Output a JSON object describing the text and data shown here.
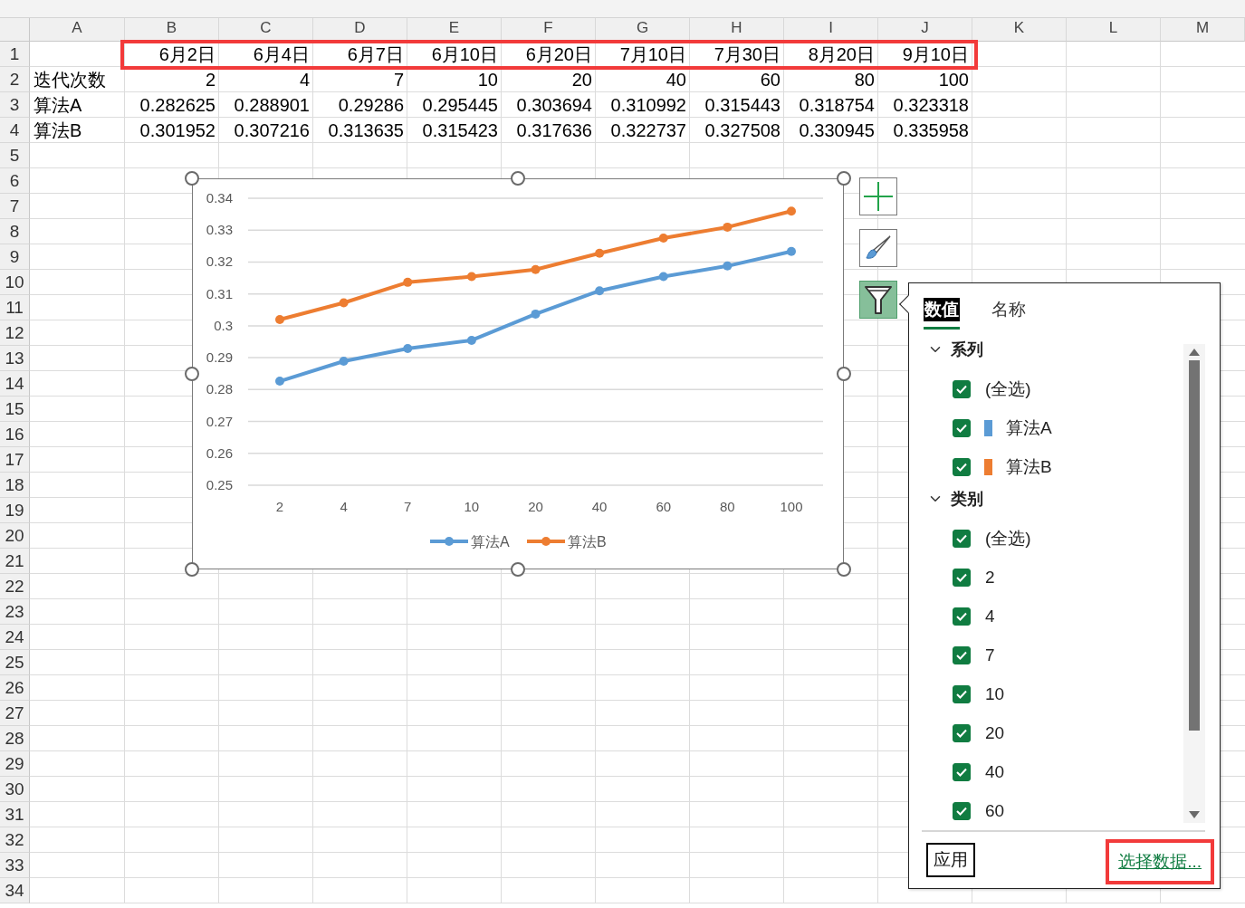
{
  "column_headers": [
    "A",
    "B",
    "C",
    "D",
    "E",
    "F",
    "G",
    "H",
    "I",
    "J",
    "K",
    "L",
    "M"
  ],
  "row_numbers": [
    "1",
    "2",
    "3",
    "4",
    "5",
    "6",
    "7",
    "8",
    "9",
    "10",
    "11",
    "12",
    "13",
    "14",
    "15",
    "16",
    "17",
    "18",
    "19",
    "20",
    "21",
    "22",
    "23",
    "24",
    "25",
    "26",
    "27",
    "28",
    "29",
    "30",
    "31",
    "32",
    "33",
    "34"
  ],
  "sheet_rows": [
    {
      "values": [
        "6月2日",
        "6月4日",
        "6月7日",
        "6月10日",
        "6月20日",
        "7月10日",
        "7月30日",
        "8月20日",
        "9月10日"
      ],
      "highlighted": true
    },
    {
      "label": "迭代次数",
      "values": [
        "2",
        "4",
        "7",
        "10",
        "20",
        "40",
        "60",
        "80",
        "100"
      ],
      "highlighted": false
    },
    {
      "label": "算法A",
      "values": [
        "0.282625",
        "0.288901",
        "0.29286",
        "0.295445",
        "0.303694",
        "0.310992",
        "0.315443",
        "0.318754",
        "0.323318"
      ],
      "highlighted": false
    },
    {
      "label": "算法B",
      "values": [
        "0.301952",
        "0.307216",
        "0.313635",
        "0.315423",
        "0.317636",
        "0.322737",
        "0.327508",
        "0.330945",
        "0.335958"
      ],
      "highlighted": false
    }
  ],
  "chart": {
    "selected": true,
    "chart_data": {
      "type": "line",
      "grid": true,
      "legend": true,
      "categories": [
        "2",
        "4",
        "7",
        "10",
        "20",
        "40",
        "60",
        "80",
        "100"
      ],
      "ylim": [
        0.25,
        0.34
      ],
      "yticks": [
        {
          "value": 0.25,
          "label": "0.25"
        },
        {
          "value": 0.26,
          "label": "0.26"
        },
        {
          "value": 0.27,
          "label": "0.27"
        },
        {
          "value": 0.28,
          "label": "0.28"
        },
        {
          "value": 0.29,
          "label": "0.29"
        },
        {
          "value": 0.3,
          "label": "0.3"
        },
        {
          "value": 0.31,
          "label": "0.31"
        },
        {
          "value": 0.32,
          "label": "0.32"
        },
        {
          "value": 0.33,
          "label": "0.33"
        },
        {
          "value": 0.34,
          "label": "0.34"
        }
      ],
      "series": [
        {
          "name": "算法A",
          "color": "#5b9bd5",
          "marker": "circle",
          "values": [
            0.282625,
            0.288901,
            0.29286,
            0.295445,
            0.303694,
            0.310992,
            0.315443,
            0.318754,
            0.323318
          ]
        },
        {
          "name": "算法B",
          "color": "#ed7d31",
          "marker": "circle",
          "values": [
            0.301952,
            0.307216,
            0.313635,
            0.315423,
            0.317636,
            0.322737,
            0.327508,
            0.330945,
            0.335958
          ]
        }
      ]
    }
  },
  "chart_tools": [
    {
      "kind": "add",
      "selected": false
    },
    {
      "kind": "style",
      "selected": false
    },
    {
      "kind": "filter",
      "selected": true
    }
  ],
  "filter_panel": {
    "tabs": [
      {
        "label": "数值",
        "selected": true
      },
      {
        "label": "名称",
        "selected": false
      }
    ],
    "sections": [
      {
        "title": "系列",
        "expanded": true,
        "items": [
          {
            "label": "(全选)",
            "checked": true
          },
          {
            "label": "算法A",
            "checked": true,
            "color": "#5b9bd5"
          },
          {
            "label": "算法B",
            "checked": true,
            "color": "#ed7d31"
          }
        ]
      },
      {
        "title": "类别",
        "expanded": true,
        "items": [
          {
            "label": "(全选)",
            "checked": true
          },
          {
            "label": "2",
            "checked": true
          },
          {
            "label": "4",
            "checked": true
          },
          {
            "label": "7",
            "checked": true
          },
          {
            "label": "10",
            "checked": true
          },
          {
            "label": "20",
            "checked": true
          },
          {
            "label": "40",
            "checked": true
          },
          {
            "label": "60",
            "checked": true
          }
        ]
      }
    ],
    "apply_button": "应用",
    "select_data_link": {
      "label": "选择数据...",
      "highlighted": true
    }
  }
}
